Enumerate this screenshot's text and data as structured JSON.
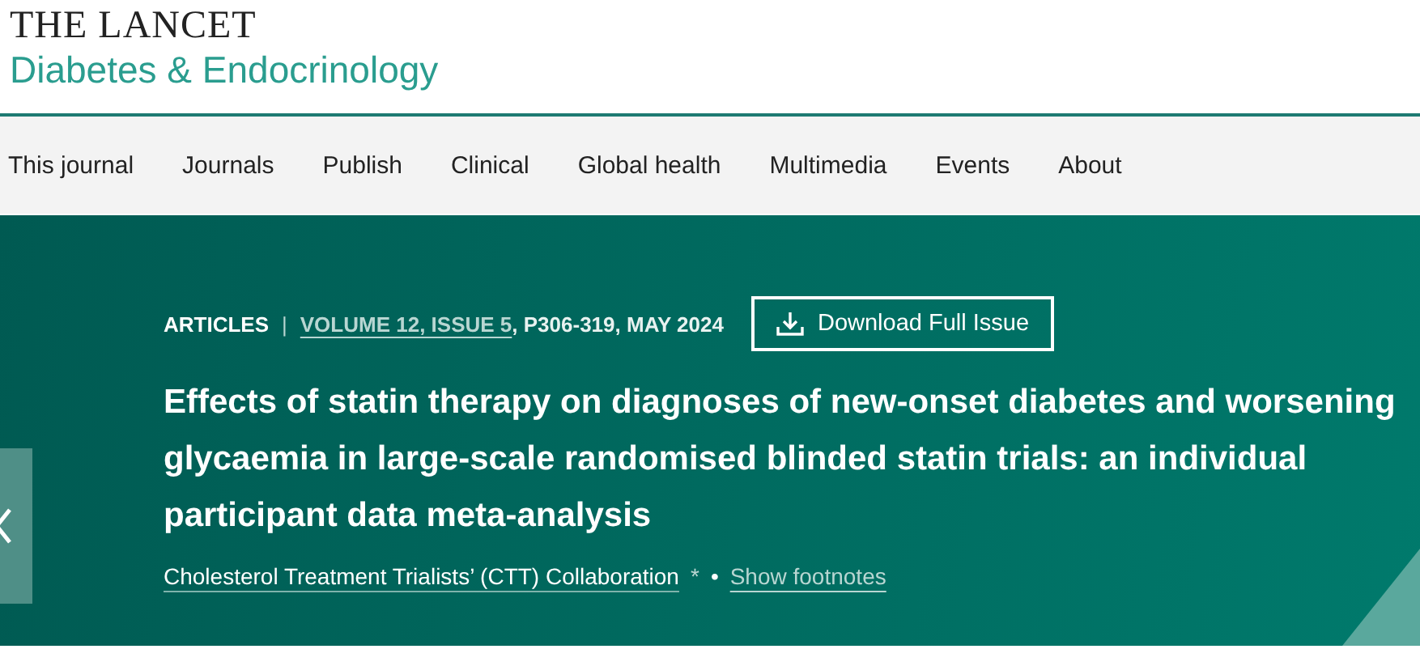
{
  "journal": {
    "publisher": "THE LANCET",
    "title": "Diabetes & Endocrinology"
  },
  "nav": {
    "items": [
      {
        "label": "This journal"
      },
      {
        "label": "Journals"
      },
      {
        "label": "Publish"
      },
      {
        "label": "Clinical"
      },
      {
        "label": "Global health"
      },
      {
        "label": "Multimedia"
      },
      {
        "label": "Events"
      },
      {
        "label": "About"
      }
    ]
  },
  "article": {
    "section": "ARTICLES",
    "separator": "|",
    "issue_link": "VOLUME 12, ISSUE 5",
    "pages_date": ", P306-319, MAY 2024",
    "download_button": "Download Full Issue",
    "title": "Effects of statin therapy on diagnoses of new-onset diabetes and worsening glycaemia in large-scale randomised blinded statin trials: an individual participant data meta-analysis",
    "author": "Cholesterol Treatment Trialists’ (CTT) Collaboration",
    "author_mark": "*",
    "bullet": "•",
    "footnotes_link": "Show footnotes"
  }
}
